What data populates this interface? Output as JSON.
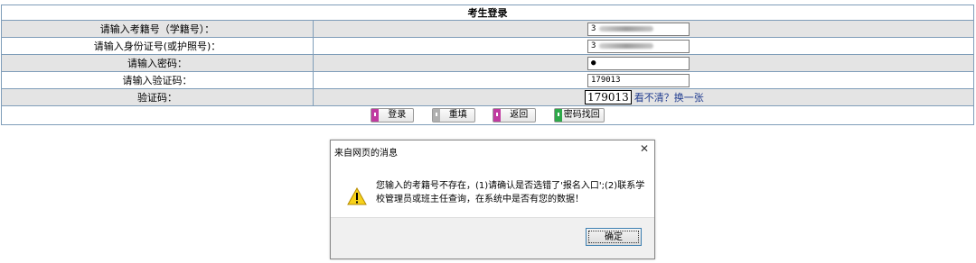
{
  "form": {
    "title": "考生登录",
    "rows": [
      {
        "label": "请输入考籍号（学籍号）：",
        "value_prefix": "3"
      },
      {
        "label": "请输入身份证号(或护照号)：",
        "value_prefix": "3"
      },
      {
        "label": "请输入密码：",
        "value": "●"
      },
      {
        "label": "请输入验证码：",
        "value": "179013"
      },
      {
        "label": "验证码：",
        "captcha": "179013",
        "refresh_link": "看不清？换一张"
      }
    ],
    "buttons": [
      {
        "label": "登录",
        "icon": "pink-arrow-icon",
        "color": "#c03aa0"
      },
      {
        "label": "重填",
        "icon": "gray-arrow-icon",
        "color": "#b0b0b0"
      },
      {
        "label": "返回",
        "icon": "pink-arrow-icon",
        "color": "#c03aa0"
      },
      {
        "label": "密码找回",
        "icon": "green-arrow-icon",
        "color": "#2ea84a"
      }
    ]
  },
  "dialog": {
    "title": "来自网页的消息",
    "close": "✕",
    "message": "您输入的考籍号不存在，(1)请确认是否选错了'报名入口';(2)联系学校管理员或班主任查询，在系统中是否有您的数据！",
    "ok_label": "确定",
    "icon": "warning-icon"
  }
}
